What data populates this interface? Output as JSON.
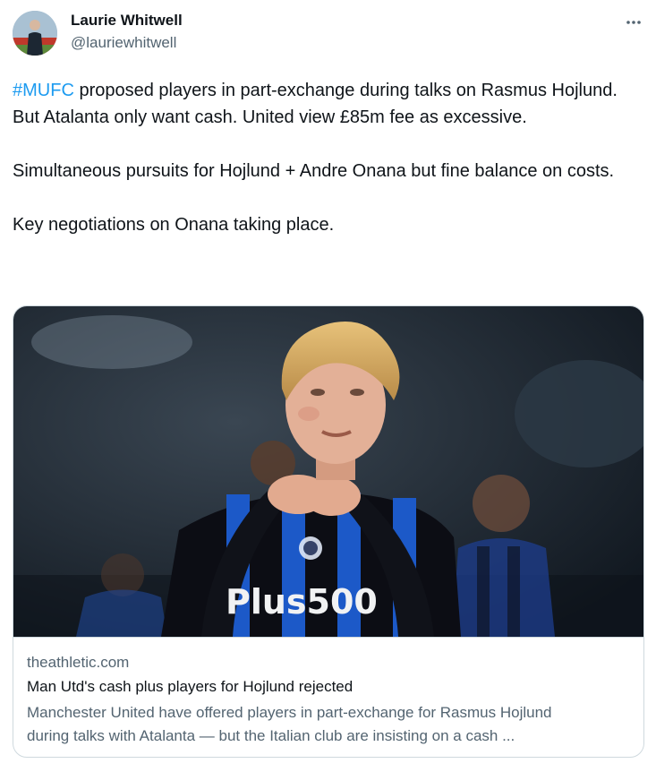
{
  "author": {
    "name": "Laurie Whitwell",
    "handle": "@lauriewhitwell"
  },
  "tweet": {
    "hashtag": "#MUFC",
    "paragraph1": " proposed players in part-exchange during talks on Rasmus Hojlund. But Atalanta only want cash. United view £85m fee as excessive.",
    "paragraph2": "Simultaneous pursuits for Hojlund + Andre Onana but fine balance on costs.",
    "paragraph3": "Key negotiations on Onana taking place."
  },
  "card": {
    "image_shirt_text": "Plus500",
    "domain": "theathletic.com",
    "title": "Man Utd's cash plus players for Hojlund rejected",
    "description_line1": "Manchester United have offered players in part-exchange for Rasmus Hojlund",
    "description_line2": "during talks with Atalanta — but the Italian club are insisting on a cash ..."
  },
  "icons": {
    "more": "more-horizontal-icon"
  },
  "colors": {
    "hashtag": "#1d9bf0",
    "text_primary": "#0f1419",
    "text_secondary": "#536471",
    "border": "#cfd9de"
  }
}
